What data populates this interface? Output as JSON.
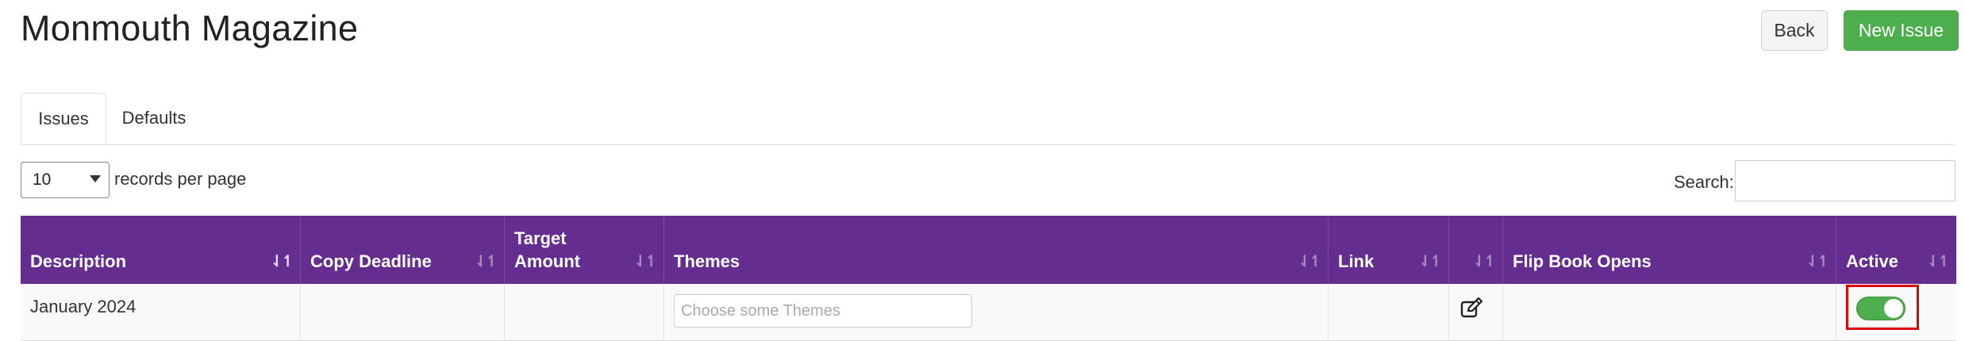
{
  "header": {
    "title": "Monmouth Magazine",
    "back_label": "Back",
    "new_issue_label": "New Issue"
  },
  "tabs": [
    {
      "label": "Issues",
      "active": true
    },
    {
      "label": "Defaults",
      "active": false
    }
  ],
  "table_controls": {
    "page_length_value": "10",
    "page_length_label": "records per page",
    "search_label": "Search:",
    "search_value": ""
  },
  "table": {
    "columns": [
      {
        "label": "Description",
        "sort_icon": "sort-desc-icon"
      },
      {
        "label": "Copy Deadline",
        "sort_icon": "sort-icon"
      },
      {
        "label": "Target Amount",
        "sort_icon": "sort-icon"
      },
      {
        "label": "Themes",
        "sort_icon": "sort-icon"
      },
      {
        "label": "Link",
        "sort_icon": "sort-icon"
      },
      {
        "label": "",
        "sort_icon": "sort-icon"
      },
      {
        "label": "Flip Book Opens",
        "sort_icon": "sort-icon"
      },
      {
        "label": "Active",
        "sort_icon": "sort-icon"
      }
    ],
    "rows": [
      {
        "description": "January 2024",
        "copy_deadline": "",
        "target_amount": "",
        "themes_placeholder": "Choose some Themes",
        "link": "",
        "action_icon": "edit-icon",
        "flip_book_opens": "",
        "active": true
      }
    ]
  },
  "colors": {
    "header_bg": "#662d91",
    "new_issue_bg": "#4cae4c",
    "toggle_on": "#4cae4c",
    "highlight": "#e00000"
  }
}
